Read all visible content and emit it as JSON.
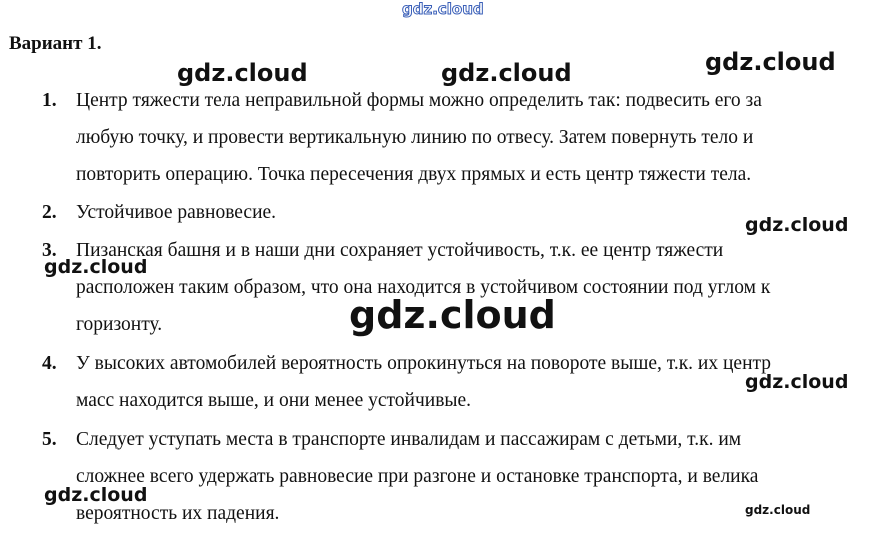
{
  "heading": "Вариант 1.",
  "items": [
    {
      "number": "1.",
      "text": "Центр тяжести тела неправильной формы можно определить так: подвесить его за\nлюбую точку, и провести вертикальную линию по отвесу. Затем повернуть тело и\nповторить операцию. Точка пересечения двух прямых и есть центр тяжести тела."
    },
    {
      "number": "2.",
      "text": "Устойчивое равновесие."
    },
    {
      "number": "3.",
      "text": "Пизанская башня и в наши дни сохраняет устойчивость, т.к. ее центр тяжести\nрасположен таким образом, что она находится в устойчивом состоянии под углом к\nгоризонту."
    },
    {
      "number": "4.",
      "text": "У высоких автомобилей вероятность опрокинуться на повороте выше, т.к. их центр\nмасс находится выше, и они менее устойчивые."
    },
    {
      "number": "5.",
      "text": "Следует уступать места в транспорте инвалидам и пассажирам с детьми, т.к. им\nсложнее всего удержать равновесие при разгоне и остановке транспорта, и велика\nвероятность их падения."
    }
  ],
  "watermarks": [
    "gdz.cloud",
    "gdz.cloud",
    "gdz.cloud",
    "gdz.cloud",
    "gdz.cloud",
    "gdz.cloud",
    "gdz.cloud",
    "gdz.cloud",
    "gdz.cloud",
    "gdz.cloud"
  ]
}
